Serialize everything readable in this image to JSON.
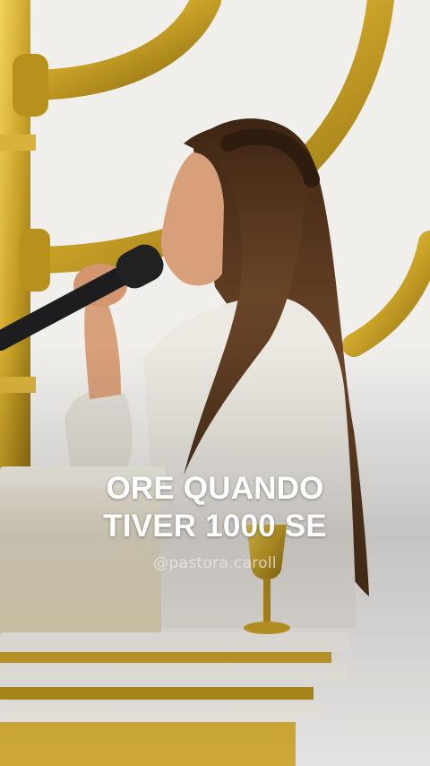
{
  "video": {
    "caption_line_1": "ORE QUANDO",
    "caption_line_2": "TIVER 1000 SE",
    "watermark": "@pastora.caroll"
  },
  "colors": {
    "gold": "#c9a227",
    "wall": "#f1efec",
    "blouse": "#ece8e2",
    "hair": "#5a3a22",
    "skin": "#d8a07a"
  }
}
